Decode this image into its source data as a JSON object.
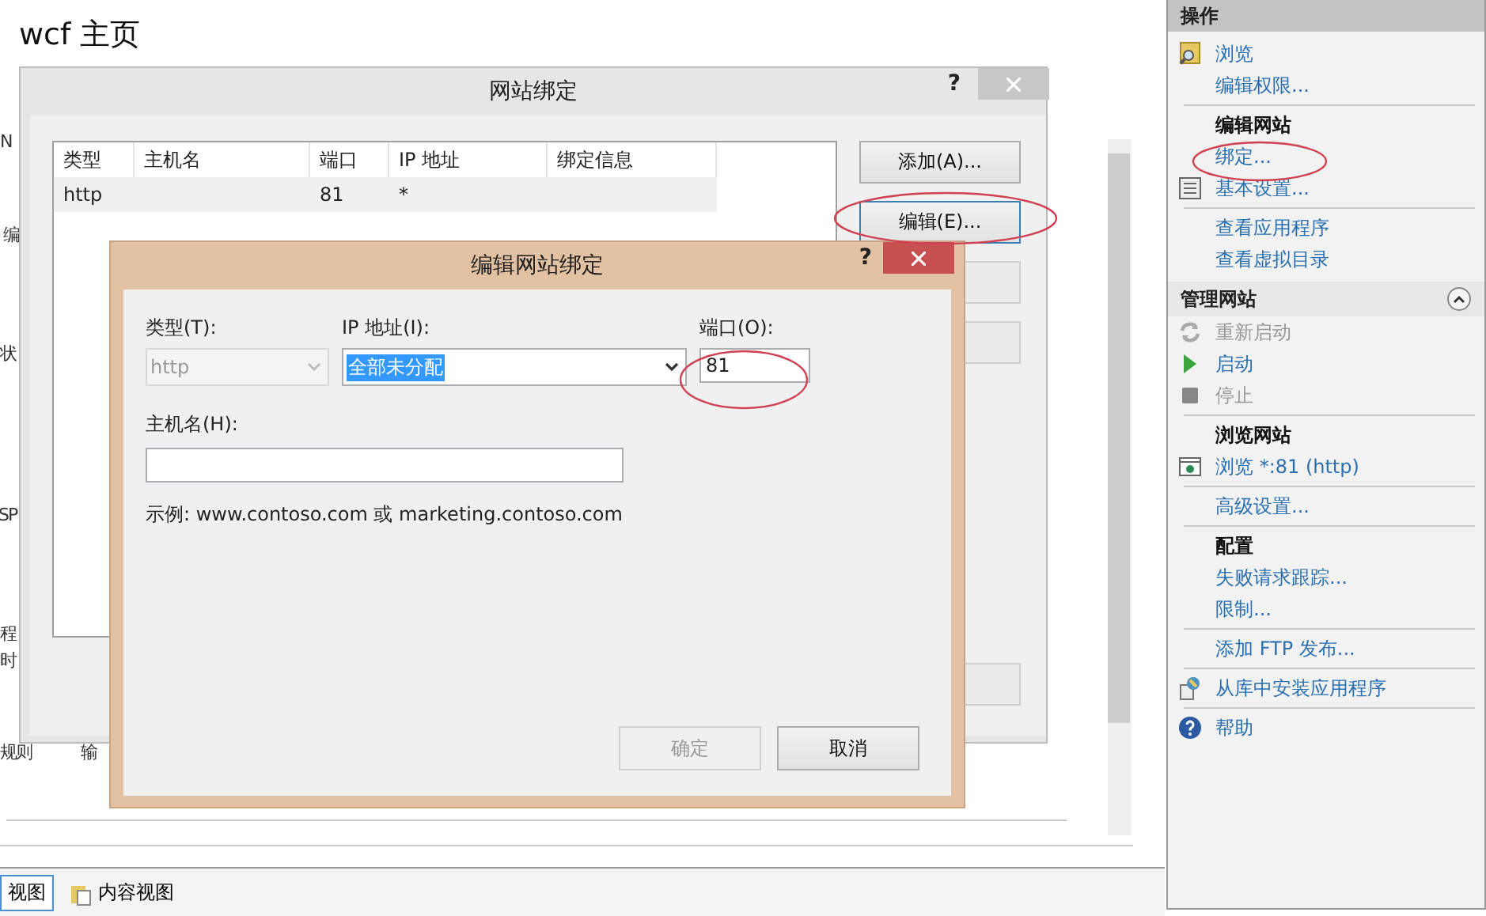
{
  "page": {
    "title": "wcf 主页",
    "fragments": [
      "N",
      "编",
      "状",
      "SP",
      "程",
      "时",
      "规则",
      "输"
    ]
  },
  "bottom_tabs": [
    {
      "label": "视图",
      "selected": true
    },
    {
      "label": "内容视图",
      "selected": false
    }
  ],
  "bindings_dialog": {
    "title": "网站绑定",
    "help": "?",
    "columns": [
      "类型",
      "主机名",
      "端口",
      "IP 地址",
      "绑定信息"
    ],
    "rows": [
      {
        "cells": [
          "http",
          "",
          "81",
          "*",
          ""
        ],
        "selected": true
      }
    ],
    "buttons": [
      {
        "label": "添加(A)...",
        "focused": false
      },
      {
        "label": "编辑(E)...",
        "focused": true
      }
    ]
  },
  "edit_dialog": {
    "title": "编辑网站绑定",
    "help": "?",
    "type_label": "类型(T):",
    "type_value": "http",
    "type_disabled": true,
    "ip_label": "IP 地址(I):",
    "ip_value": "全部未分配",
    "port_label": "端口(O):",
    "port_value": "81",
    "host_label": "主机名(H):",
    "example": "示例: www.contoso.com 或 marketing.contoso.com",
    "buttons": [
      {
        "label": "确定",
        "disabled": true
      },
      {
        "label": "取消",
        "disabled": false
      }
    ]
  },
  "actions": {
    "title": "操作",
    "items": [
      {
        "kind": "link",
        "label": "浏览",
        "disabled": false
      },
      {
        "kind": "link",
        "label": "编辑权限...",
        "disabled": false
      },
      {
        "kind": "divider"
      },
      {
        "kind": "heading",
        "label": "编辑网站"
      },
      {
        "kind": "link",
        "label": "绑定...",
        "disabled": false
      },
      {
        "kind": "link",
        "label": "基本设置...",
        "disabled": false
      },
      {
        "kind": "divider"
      },
      {
        "kind": "link",
        "label": "查看应用程序",
        "disabled": false
      },
      {
        "kind": "link",
        "label": "查看虚拟目录",
        "disabled": false
      },
      {
        "kind": "section",
        "label": "管理网站",
        "expanded": true
      },
      {
        "kind": "link",
        "label": "重新启动",
        "disabled": true
      },
      {
        "kind": "link",
        "label": "启动",
        "disabled": false
      },
      {
        "kind": "link",
        "label": "停止",
        "disabled": true
      },
      {
        "kind": "divider"
      },
      {
        "kind": "heading",
        "label": "浏览网站"
      },
      {
        "kind": "link",
        "label": "浏览 *:81 (http)",
        "disabled": false
      },
      {
        "kind": "divider"
      },
      {
        "kind": "link",
        "label": "高级设置...",
        "disabled": false
      },
      {
        "kind": "divider"
      },
      {
        "kind": "heading",
        "label": "配置"
      },
      {
        "kind": "link",
        "label": "失败请求跟踪...",
        "disabled": false
      },
      {
        "kind": "link",
        "label": "限制...",
        "disabled": false
      },
      {
        "kind": "divider"
      },
      {
        "kind": "link",
        "label": "添加 FTP 发布...",
        "disabled": false
      },
      {
        "kind": "divider"
      },
      {
        "kind": "link",
        "label": "从库中安装应用程序",
        "disabled": false
      },
      {
        "kind": "divider"
      },
      {
        "kind": "link",
        "label": "帮助",
        "disabled": false
      }
    ]
  }
}
